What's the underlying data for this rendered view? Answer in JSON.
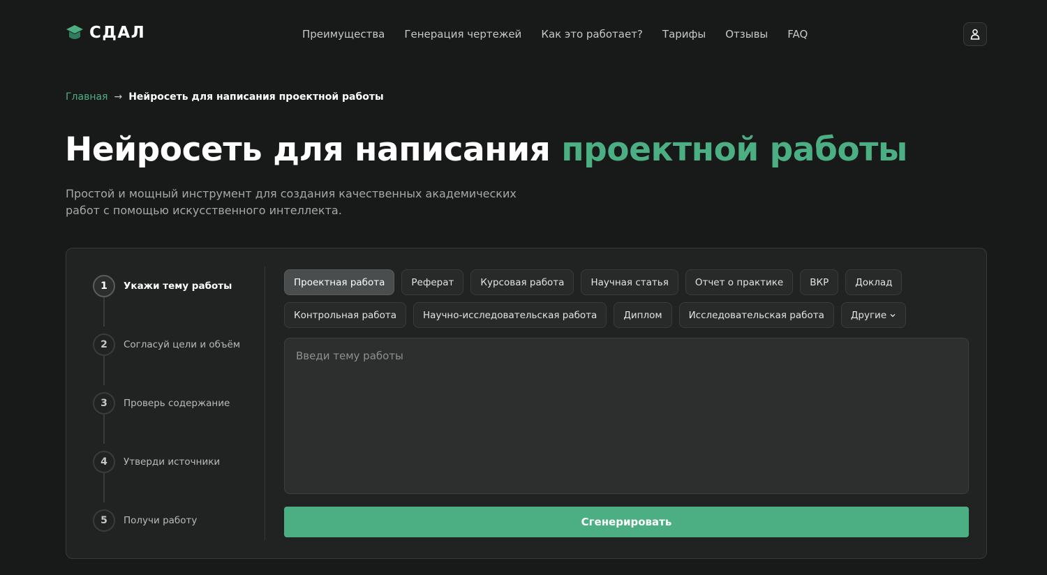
{
  "header": {
    "logo_text": "СДАЛ",
    "nav": [
      {
        "label": "Преимущества"
      },
      {
        "label": "Генерация чертежей"
      },
      {
        "label": "Как это работает?"
      },
      {
        "label": "Тарифы"
      },
      {
        "label": "Отзывы"
      },
      {
        "label": "FAQ"
      }
    ],
    "profile_icon": "user-icon"
  },
  "breadcrumb": {
    "home": "Главная",
    "separator": "→",
    "current": "Нейросеть для написания проектной работы"
  },
  "hero": {
    "title_main": "Нейросеть для написания ",
    "title_accent": "проектной работы",
    "subtitle": "Простой и мощный инструмент для создания качественных академических работ с помощью искусственного интеллекта."
  },
  "steps": [
    {
      "number": "1",
      "label": "Укажи тему работы"
    },
    {
      "number": "2",
      "label": "Согласуй цели и объём"
    },
    {
      "number": "3",
      "label": "Проверь содержание"
    },
    {
      "number": "4",
      "label": "Утверди источники"
    },
    {
      "number": "5",
      "label": "Получи работу"
    }
  ],
  "work_types": {
    "row1": [
      "Проектная работа",
      "Реферат",
      "Курсовая работа",
      "Научная статья",
      "Отчет о практике",
      "ВКР",
      "Доклад"
    ],
    "row2": [
      "Контрольная работа",
      "Научно-исследовательская работа",
      "Диплом",
      "Исследовательская работа",
      "Другие"
    ],
    "selected": "Проектная работа"
  },
  "topic_input": {
    "placeholder": "Введи тему работы",
    "value": ""
  },
  "generate_button": "Сгенерировать",
  "colors": {
    "background": "#181919",
    "accent": "#4caf83",
    "card": "#212222"
  }
}
